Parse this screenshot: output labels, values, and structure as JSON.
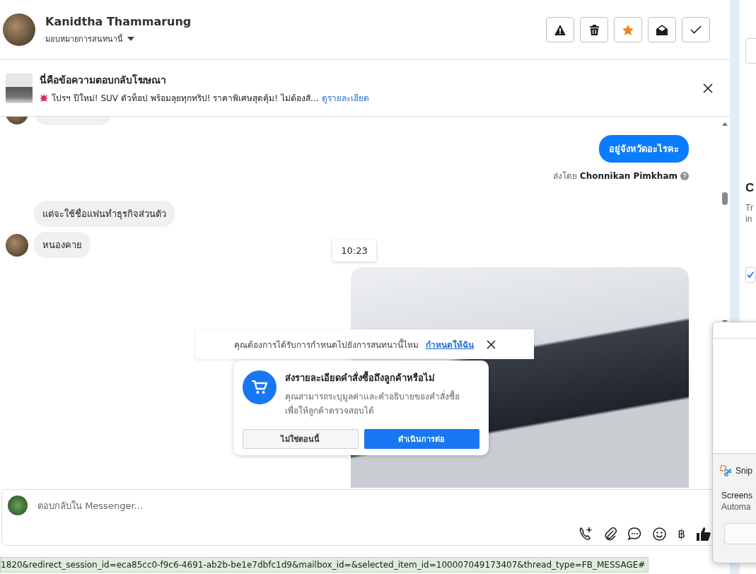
{
  "header": {
    "name": "Kanidtha Thammarung",
    "assign_label": "มอบหมายการสนทนานี้"
  },
  "toolbar": [
    {
      "kind": "spam"
    },
    {
      "kind": "trash"
    },
    {
      "kind": "star",
      "on": true
    },
    {
      "kind": "unread"
    },
    {
      "kind": "done"
    }
  ],
  "ad_reply": {
    "title": "นี่คือข้อความตอบกลับโฆษณา",
    "text": "โปรฯ ปีใหม่! SUV ตัวท็อป พร้อมลุยทุกทริป! ราคาพิเศษสุดคุ้ม! ไม่ต้องสั...",
    "link": "ดูรายละเอียด"
  },
  "messages": [
    {
      "kind": "outgoing",
      "text": "อยู่จังหวัดอะไรคะ",
      "sender_prefix": "ส่งโดย",
      "sender": "Chonnikan Pimkham"
    },
    {
      "kind": "incoming",
      "text": "แต่จะใช้ชื่อแฟนทำธุรกิจส่วนตัว",
      "avatar": false
    },
    {
      "kind": "incoming",
      "text": "หนองคาย",
      "avatar": true
    },
    {
      "kind": "time",
      "text": "10:23"
    },
    {
      "kind": "image"
    }
  ],
  "assign_prompt": {
    "text": "คุณต้องการได้รับการกำหนดไปยังการสนทนานี้ไหม",
    "link": "กำหนดให้ฉัน"
  },
  "order_prompt": {
    "title": "ส่งรายละเอียดคำสั่งซื้อถึงลูกค้าหรือไม่",
    "body": "คุณสามารถระบุมูลค่าและคำอธิบายของคำสั่งซื้อเพื่อให้ลูกค้าตรวจสอบได้",
    "buttons": [
      {
        "label": "ไม่ใช่ตอนนี้",
        "kind": "secondary"
      },
      {
        "label": "ดำเนินการต่อ",
        "kind": "primary"
      }
    ]
  },
  "composer": {
    "placeholder": "ตอบกลับใน Messenger...",
    "tools": [
      {
        "kind": "call"
      },
      {
        "kind": "attach"
      },
      {
        "kind": "chat"
      },
      {
        "kind": "emoji"
      },
      {
        "kind": "baht",
        "label": "฿"
      },
      {
        "kind": "like"
      }
    ]
  },
  "status_url": "1820&redirect_session_id=eca85cc0-f9c6-4691-ab2b-be1e7dbfc1d9&mailbox_id=&selected_item_id=100007049173407&thread_type=FB_MESSAGE#",
  "sidebar": {
    "fragments": [
      "C",
      "Tr",
      "in"
    ],
    "checked": true
  },
  "snip_notification": {
    "app": "Snip",
    "title": "Screens",
    "body": "Automa"
  }
}
